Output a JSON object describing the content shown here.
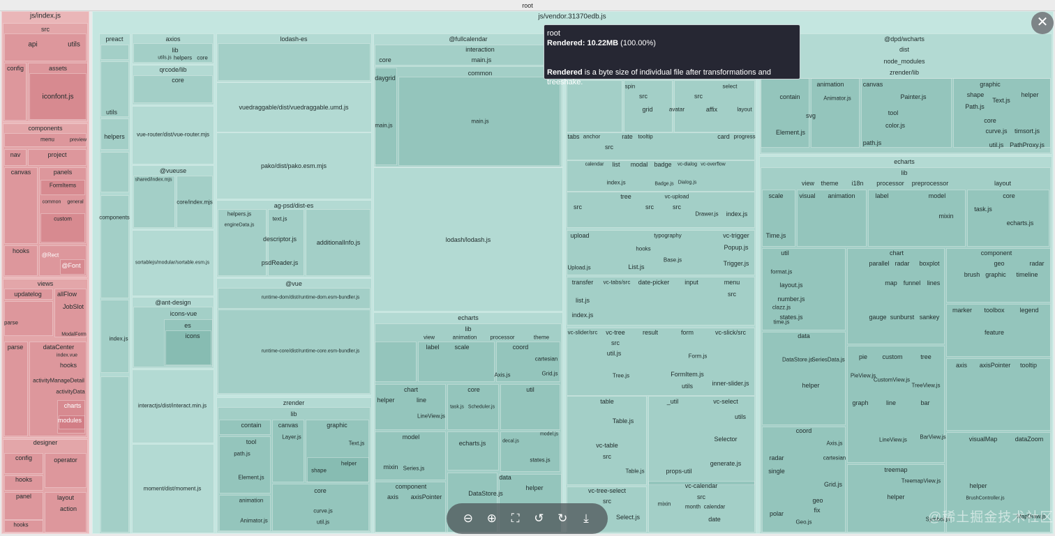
{
  "header": {
    "title": "root"
  },
  "tooltip": {
    "name": "root",
    "rendered_label": "Rendered:",
    "rendered_value": "10.22MB",
    "rendered_pct": "(100.00%)",
    "note_bold": "Rendered",
    "note_rest": " is a byte size of individual file after transformations and treeshake."
  },
  "toolbar": {
    "zoom_out": "⊖",
    "zoom_in": "⊕",
    "fit": "⛶",
    "rotate_left": "↺",
    "rotate_right": "↻",
    "download": "⤓"
  },
  "close_icon": "✕",
  "watermark": "@稀土掘金技术社区",
  "colors": {
    "entry_chunk": "#eab6b8",
    "vendor_chunk": "#c4e6e0",
    "tooltip_bg": "#262733"
  },
  "labels": [
    "js/index.js",
    "js/vendor.31370edb.js",
    "src",
    "api",
    "utils",
    "config",
    "assets",
    "iconfont.js",
    "components",
    "menu",
    "preview",
    "nav",
    "project",
    "canvas",
    "panels",
    "FormItems",
    "common",
    "general",
    "custom",
    "hooks",
    "@Rect",
    "@Font",
    "views",
    "updatelog",
    "allFlow",
    "JobSlot",
    "parse",
    "ModalForm",
    "parse",
    "dataCenter",
    "index.vue",
    "hooks",
    "activityManageDetail",
    "activityData",
    "charts",
    "modules",
    "designer",
    "config",
    "operator",
    "hooks",
    "panel",
    "layout",
    "action",
    "hooks",
    "preact",
    "utils",
    "helpers",
    "components",
    "index.js",
    "axios",
    "lib",
    "utils.js",
    "helpers",
    "core",
    "qrcode/lib",
    "core",
    "vue-router/dist/vue-router.mjs",
    "@vueuse",
    "shared/index.mjs",
    "core/index.mjs",
    "sortablejs/modular/sortable.esm.js",
    "@ant-design",
    "icons-vue",
    "es",
    "icons",
    "interactjs/dist/interact.min.js",
    "moment/dist/moment.js",
    "lodash-es",
    "vuedraggable/dist/vuedraggable.umd.js",
    "pako/dist/pako.esm.mjs",
    "ag-psd/dist-es",
    "helpers.js",
    "text.js",
    "descriptor.js",
    "additionalInfo.js",
    "psdReader.js",
    "engineData.js",
    "@vue",
    "runtime-dom/dist/runtime-dom.esm-bundler.js",
    "runtime-core/dist/runtime-core.esm-bundler.js",
    "zrender",
    "lib",
    "contain",
    "canvas",
    "graphic",
    "tool",
    "Layer.js",
    "Text.js",
    "path.js",
    "helper",
    "shape",
    "Element.js",
    "animation",
    "core",
    "curve.js",
    "util.js",
    "Animator.js",
    "@fullcalendar",
    "interaction",
    "main.js",
    "core",
    "common",
    "daygrid",
    "main.js",
    "main.js",
    "lodash/lodash.js",
    "echarts",
    "lib",
    "view",
    "animation",
    "processor",
    "theme",
    "label",
    "scale",
    "coord",
    "cartesian",
    "Axis.js",
    "Grid.js",
    "chart",
    "core",
    "util",
    "helper",
    "line",
    "LineView.js",
    "task.js",
    "Scheduler.js",
    "model",
    "echarts.js",
    "model.js",
    "decal.js",
    "mixin",
    "Series.js",
    "states.js",
    "data",
    "helper",
    "component",
    "axis",
    "axisPointer",
    "DataStore.js",
    "spin",
    "select",
    "src",
    "src",
    "grid",
    "avatar",
    "affix",
    "layout",
    "tabs",
    "anchor",
    "rate",
    "tooltip",
    "card",
    "progress",
    "src",
    "calendar",
    "list",
    "modal",
    "badge",
    "vc-dialog",
    "vc-overflow",
    "index.js",
    "Badge.js",
    "Dialog.js",
    "tree",
    "vc-upload",
    "src",
    "src",
    "src",
    "Drawer.js",
    "index.js",
    "upload",
    "typography",
    "vc-trigger",
    "hooks",
    "Base.js",
    "Popup.js",
    "List.js",
    "Trigger.js",
    "Upload.js",
    "transfer",
    "vc-tabs/src",
    "date-picker",
    "input",
    "menu",
    "src",
    "list.js",
    "index.js",
    "vc-slider/src",
    "vc-tree",
    "result",
    "form",
    "vc-slick/src",
    "src",
    "util.js",
    "Form.js",
    "FormItem.js",
    "inner-slider.js",
    "utils",
    "Tree.js",
    "table",
    "_util",
    "vc-select",
    "utils",
    "Table.js",
    "Selector",
    "vc-table",
    "src",
    "generate.js",
    "Table.js",
    "props-util",
    "vc-calendar",
    "vc-tree-select",
    "src",
    "src",
    "mixin",
    "month",
    "calendar",
    "Select.js",
    "date",
    "@dpd/wcharts",
    "dist",
    "node_modules",
    "zrender/lib",
    "animation",
    "canvas",
    "graphic",
    "contain",
    "helper",
    "Animator.js",
    "Painter.js",
    "shape",
    "Text.js",
    "svg",
    "tool",
    "Path.js",
    "color.js",
    "core",
    "curve.js",
    "timsort.js",
    "Element.js",
    "path.js",
    "util.js",
    "PathProxy.js",
    "echarts",
    "lib",
    "view",
    "theme",
    "i18n",
    "processor",
    "preprocessor",
    "layout",
    "scale",
    "visual",
    "animation",
    "label",
    "model",
    "core",
    "task.js",
    "mixin",
    "echarts.js",
    "Time.js",
    "util",
    "chart",
    "component",
    "format.js",
    "parallel",
    "radar",
    "boxplot",
    "geo",
    "radar",
    "layout.js",
    "brush",
    "graphic",
    "timeline",
    "map",
    "funnel",
    "lines",
    "number.js",
    "clazz.js",
    "marker",
    "toolbox",
    "legend",
    "gauge",
    "sunburst",
    "sankey",
    "states.js",
    "time.js",
    "feature",
    "data",
    "DataStore.js",
    "SeriesData.js",
    "pie",
    "custom",
    "tree",
    "axis",
    "axisPointer",
    "tooltip",
    "PieView.js",
    "CustomView.js",
    "TreeView.js",
    "helper",
    "graph",
    "line",
    "bar",
    "coord",
    "visualMap",
    "dataZoom",
    "radar",
    "cartesian",
    "single",
    "Axis.js",
    "Grid.js",
    "treemap",
    "TreemapView.js",
    "LineView.js",
    "BarView.js",
    "helper",
    "helper",
    "geo",
    "fix",
    "polar",
    "Geo.js",
    "BrushController.js",
    "Symbol.js",
    "MapDraw.js"
  ]
}
